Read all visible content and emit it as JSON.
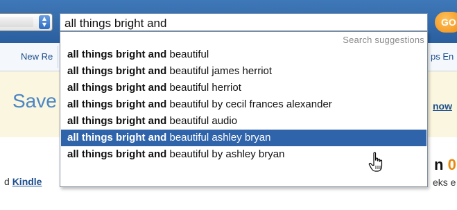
{
  "search": {
    "query": "all things bright and",
    "go_label": "GO"
  },
  "dropdown": {
    "title": "Search suggestions",
    "items": [
      {
        "bold": "all things bright and",
        "rest": " beautiful",
        "selected": false
      },
      {
        "bold": "all things bright and",
        "rest": " beautiful james herriot",
        "selected": false
      },
      {
        "bold": "all things bright and",
        "rest": " beautiful herriot",
        "selected": false
      },
      {
        "bold": "all things bright and",
        "rest": " beautiful by cecil frances alexander",
        "selected": false
      },
      {
        "bold": "all things bright and",
        "rest": " beautiful audio",
        "selected": false
      },
      {
        "bold": "all things bright and",
        "rest": " beautiful ashley bryan",
        "selected": true
      },
      {
        "bold": "all things bright and",
        "rest": " beautiful by ashley bryan",
        "selected": false
      }
    ]
  },
  "page": {
    "nav_left": "New Re",
    "nav_right": "ps En",
    "promo_text": "Save",
    "now_link": "now",
    "kindle_prefix": "d ",
    "kindle_link": "Kindle",
    "right_big_prefix": "n ",
    "right_big_accent": "0",
    "right_small": "eks e"
  },
  "colors": {
    "topbar": "#2a5f9f",
    "selected_row": "#2f63aa",
    "link": "#1b4d8c",
    "go_button": "#f08a10",
    "promo_bg": "#fbf6df"
  },
  "icons": {
    "cursor": "hand-pointer-icon",
    "select_arrows": "up-down-arrows-icon"
  }
}
